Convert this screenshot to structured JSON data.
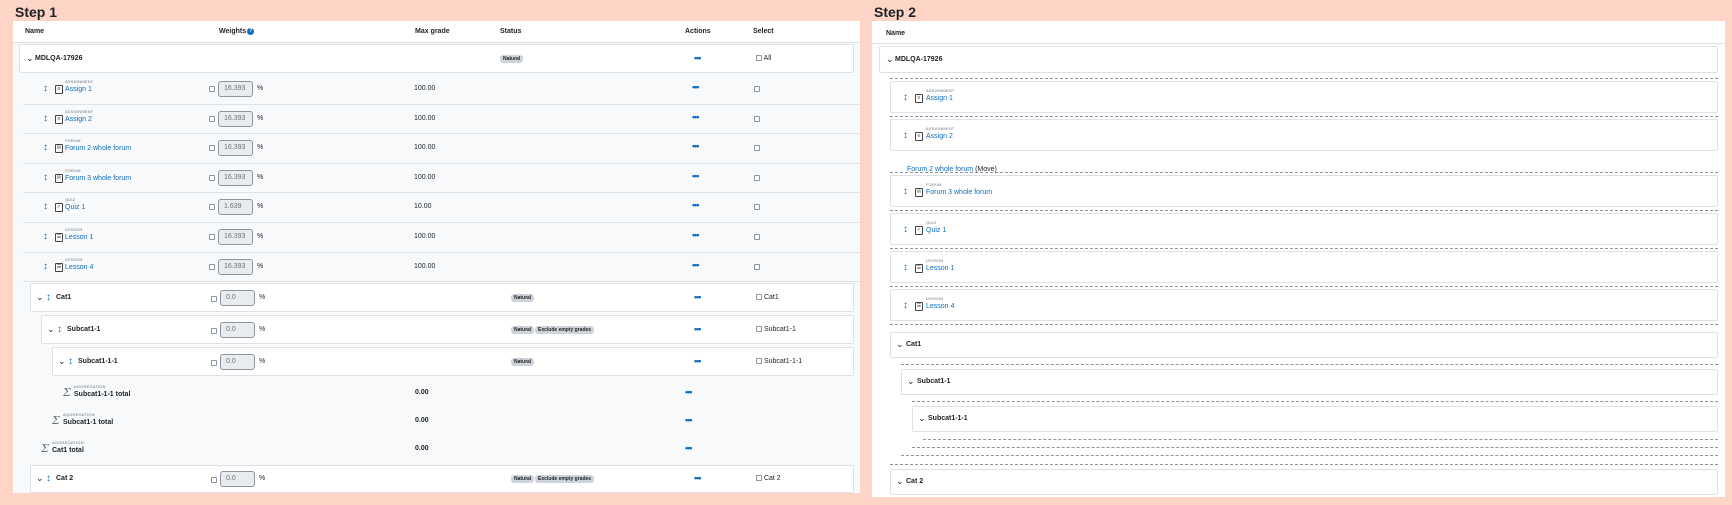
{
  "step1": {
    "title": "Step 1",
    "columns": {
      "name": "Name",
      "weights": "Weights",
      "max_grade": "Max grade",
      "status": "Status",
      "actions": "Actions",
      "select": "Select"
    },
    "course": {
      "name": "MDLQA-17926",
      "status": "Natural",
      "select": "All"
    },
    "items": [
      {
        "type": "ASSIGNMENT",
        "name": "Assign 1",
        "weight": "16.393",
        "max": "100.00",
        "icon": "assignment-icon"
      },
      {
        "type": "ASSIGNMENT",
        "name": "Assign 2",
        "weight": "16.393",
        "max": "100.00",
        "icon": "assignment-icon"
      },
      {
        "type": "FORUM",
        "name": "Forum 2 whole forum",
        "weight": "16.393",
        "max": "100.00",
        "icon": "forum-icon"
      },
      {
        "type": "FORUM",
        "name": "Forum 3 whole forum",
        "weight": "16.393",
        "max": "100.00",
        "icon": "forum-icon"
      },
      {
        "type": "QUIZ",
        "name": "Quiz 1",
        "weight": "1.639",
        "max": "10.00",
        "icon": "quiz-icon"
      },
      {
        "type": "LESSON",
        "name": "Lesson 1",
        "weight": "16.393",
        "max": "100.00",
        "icon": "lesson-icon"
      },
      {
        "type": "LESSON",
        "name": "Lesson 4",
        "weight": "16.393",
        "max": "100.00",
        "icon": "lesson-icon"
      }
    ],
    "cat1": {
      "name": "Cat1",
      "weight": "0.0",
      "status": "Natural",
      "select": "Cat1"
    },
    "subcat1": {
      "name": "Subcat1-1",
      "weight": "0.0",
      "status": "Natural",
      "status2": "Exclude empty grades",
      "select": "Subcat1-1"
    },
    "subcat11": {
      "name": "Subcat1-1-1",
      "weight": "0.0",
      "status": "Natural",
      "select": "Subcat1-1-1"
    },
    "totals": [
      {
        "type": "AGGREGATION",
        "name": "Subcat1-1-1 total",
        "max": "0.00"
      },
      {
        "type": "AGGREGATION",
        "name": "Subcat1-1 total",
        "max": "0.00"
      },
      {
        "type": "AGGREGATION",
        "name": "Cat1 total",
        "max": "0.00"
      }
    ],
    "cat2": {
      "name": "Cat 2",
      "weight": "0.0",
      "status": "Natural",
      "status2": "Exclude empty grades",
      "select": "Cat 2"
    },
    "percent": "%",
    "actions_glyph": "•••"
  },
  "step2": {
    "title": "Step 2",
    "column_name": "Name",
    "course": "MDLQA-17926",
    "items": [
      {
        "type": "ASSIGNMENT",
        "name": "Assign 1"
      },
      {
        "type": "ASSIGNMENT",
        "name": "Assign 2"
      },
      {
        "type": "FORUM",
        "name": "Forum 3 whole forum"
      },
      {
        "type": "QUIZ",
        "name": "Quiz 1"
      },
      {
        "type": "LESSON",
        "name": "Lesson 1"
      },
      {
        "type": "LESSON",
        "name": "Lesson 4"
      }
    ],
    "moving": {
      "name": "Forum 2 whole forum",
      "label": "(Move)"
    },
    "cat1": "Cat1",
    "subcat1": "Subcat1-1",
    "subcat11": "Subcat1-1-1",
    "cat2": "Cat 2"
  },
  "colors": {
    "background": "#fed4c7",
    "link": "#0f6cbf",
    "badge": "#ced4da"
  }
}
